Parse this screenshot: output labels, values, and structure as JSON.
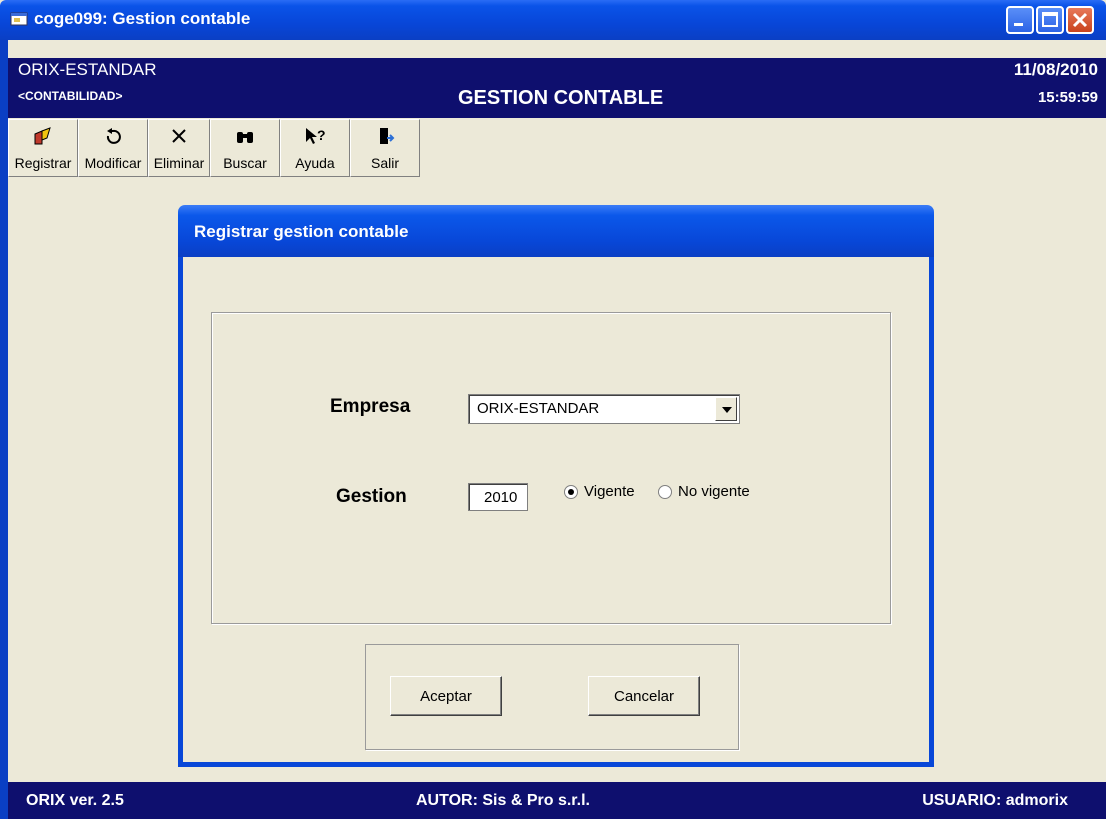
{
  "window": {
    "title": "coge099: Gestion contable"
  },
  "header": {
    "company": "ORIX-ESTANDAR",
    "module": "<CONTABILIDAD>",
    "title": "GESTION CONTABLE",
    "date": "11/08/2010",
    "time": "15:59:59"
  },
  "toolbar": {
    "items": [
      {
        "label": "Registrar",
        "icon": "register-icon"
      },
      {
        "label": "Modificar",
        "icon": "undo-icon"
      },
      {
        "label": "Eliminar",
        "icon": "delete-x-icon"
      },
      {
        "label": "Buscar",
        "icon": "binoculars-icon"
      },
      {
        "label": "Ayuda",
        "icon": "help-cursor-icon"
      },
      {
        "label": "Salir",
        "icon": "exit-door-icon"
      }
    ]
  },
  "dialog": {
    "title": "Registrar gestion contable",
    "empresa_label": "Empresa",
    "empresa_value": "ORIX-ESTANDAR",
    "gestion_label": "Gestion",
    "gestion_value": "2010",
    "radio_vigente": "Vigente",
    "radio_no_vigente": "No vigente",
    "selected_radio": "Vigente",
    "accept_label": "Aceptar",
    "cancel_label": "Cancelar"
  },
  "status": {
    "version": "ORIX ver. 2.5",
    "author": "AUTOR: Sis & Pro s.r.l.",
    "user": "USUARIO: admorix"
  },
  "colors": {
    "header_bg": "#0E0F6E",
    "face": "#ECE9D8",
    "xp_blue": "#0847D8"
  }
}
